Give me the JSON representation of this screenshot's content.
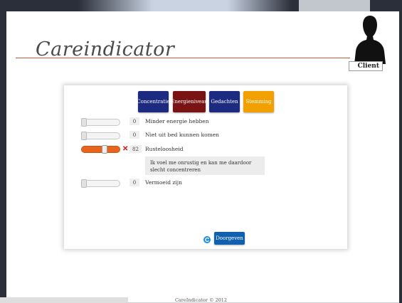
{
  "logo": {
    "text": "Careindicator"
  },
  "user": {
    "label": "Client"
  },
  "tabs": [
    {
      "label": "Concentratie",
      "color": "#1c2a80"
    },
    {
      "label": "Energieniveau",
      "color": "#7a1414"
    },
    {
      "label": "Gedachten",
      "color": "#1c2a80"
    },
    {
      "label": "Stemming",
      "color": "#f2a000"
    }
  ],
  "items": [
    {
      "label": "Minder energie hebben",
      "value": "0",
      "level_percent": 0
    },
    {
      "label": "Niet uit bed kunnen komen",
      "value": "0",
      "level_percent": 0
    },
    {
      "label": "Rusteloosheid",
      "value": "82",
      "level_percent": 82,
      "comment": "Ik voel me onrustig en kan me daardoor slecht concentreren"
    },
    {
      "label": "Vermoeid zijn",
      "value": "0",
      "level_percent": 0
    }
  ],
  "submit": {
    "label": "Doorgeven"
  },
  "footer": {
    "text": "CareIndicator © 2012"
  },
  "colors": {
    "accent": "#e8641c",
    "logo_line": "#c65a2e",
    "submit": "#1060b0"
  }
}
